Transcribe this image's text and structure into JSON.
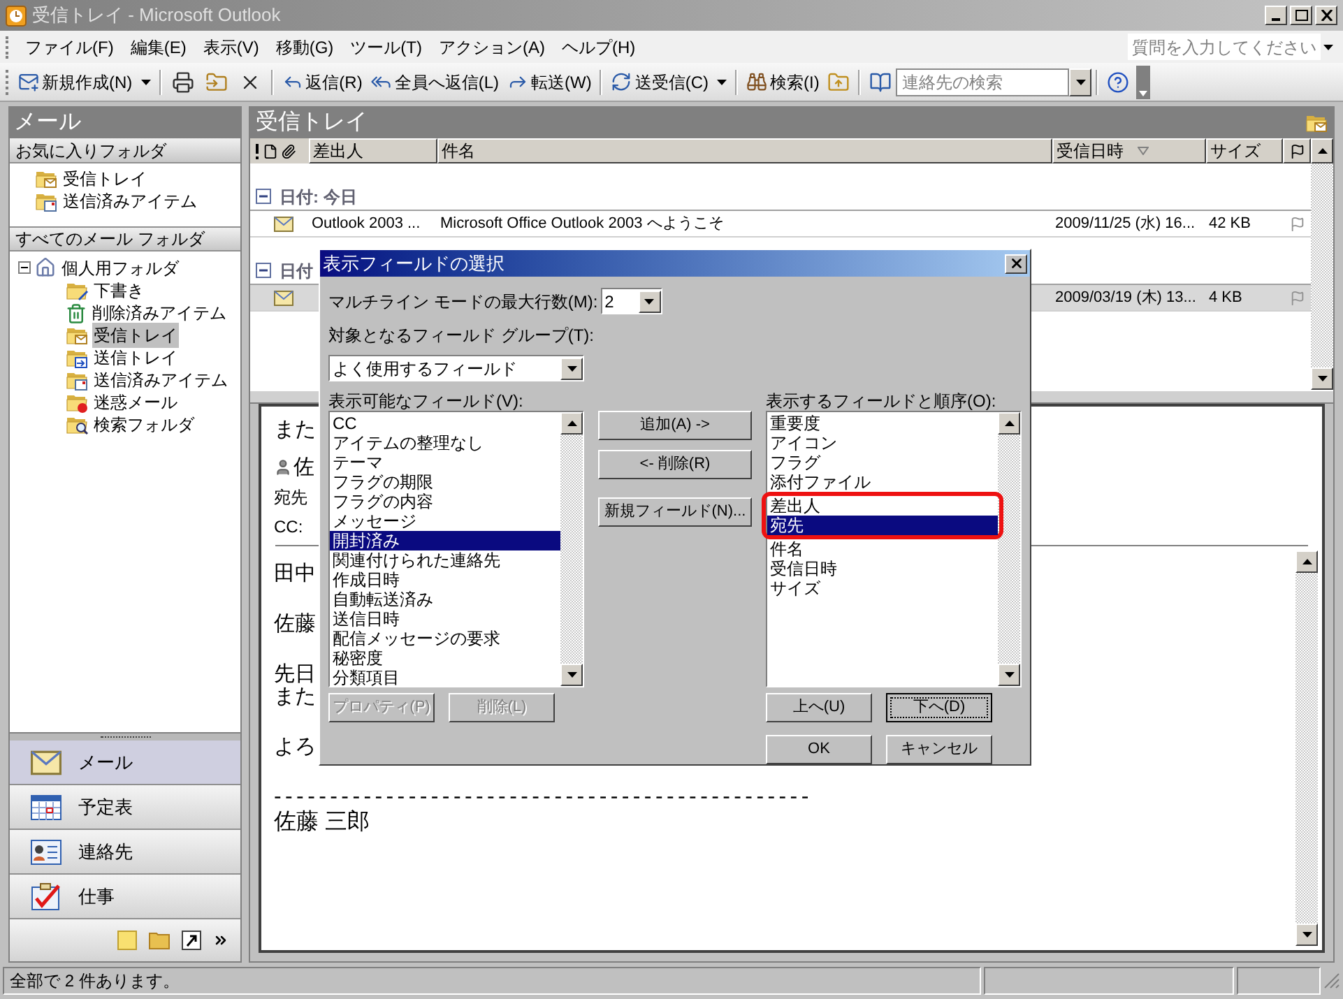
{
  "window": {
    "title": "受信トレイ - Microsoft Outlook"
  },
  "menu": [
    "ファイル(F)",
    "編集(E)",
    "表示(V)",
    "移動(G)",
    "ツール(T)",
    "アクション(A)",
    "ヘルプ(H)"
  ],
  "help_search": {
    "placeholder": "質問を入力してください"
  },
  "toolbar": {
    "new": "新規作成(N)",
    "reply": "返信(R)",
    "reply_all": "全員へ返信(L)",
    "forward": "転送(W)",
    "send_receive": "送受信(C)",
    "find": "検索(I)",
    "contact_search": {
      "placeholder": "連絡先の検索"
    }
  },
  "nav": {
    "title": "メール",
    "favorites": {
      "heading": "お気に入りフォルダ",
      "items": [
        {
          "label": "受信トレイ"
        },
        {
          "label": "送信済みアイテム"
        }
      ]
    },
    "all_folders": {
      "heading": "すべてのメール フォルダ",
      "tree": [
        {
          "label": "個人用フォルダ",
          "expanded": true,
          "selected": false,
          "children": [
            {
              "label": "下書き",
              "selected": false
            },
            {
              "label": "削除済みアイテム",
              "selected": false
            },
            {
              "label": "受信トレイ",
              "selected": true
            },
            {
              "label": "送信トレイ",
              "selected": false
            },
            {
              "label": "送信済みアイテム",
              "selected": false
            },
            {
              "label": "迷惑メール",
              "selected": false
            },
            {
              "label": "検索フォルダ",
              "selected": false
            }
          ]
        }
      ]
    },
    "buttons": [
      {
        "label": "メール",
        "selected": true
      },
      {
        "label": "予定表",
        "selected": false
      },
      {
        "label": "連絡先",
        "selected": false
      },
      {
        "label": "仕事",
        "selected": false
      }
    ]
  },
  "inbox": {
    "title": "受信トレイ",
    "columns": [
      {
        "label": "差出人",
        "sorted": false
      },
      {
        "label": "件名",
        "sorted": false
      },
      {
        "label": "受信日時",
        "sorted": true
      },
      {
        "label": "サイズ",
        "sorted": false
      }
    ],
    "groups": [
      {
        "label": "日付: 今日",
        "expanded": true,
        "rows": [
          {
            "from": "Outlook 2003 ...",
            "subject": "Microsoft Office Outlook 2003 へようこそ",
            "received": "2009/11/25 (水) 16...",
            "size": "42 KB",
            "selected": false
          }
        ]
      },
      {
        "label": "日付",
        "expanded": true,
        "rows": [
          {
            "received": "2009/03/19 (木) 13...",
            "size": "4 KB",
            "selected": true
          }
        ]
      }
    ]
  },
  "reading_pane": {
    "subject": "また",
    "sender": "佐",
    "to_label": "宛先",
    "cc_label": "CC:",
    "paragraphs": [
      {
        "lines": [
          "田中"
        ]
      },
      {
        "lines": [
          "佐藤"
        ]
      },
      {
        "lines": [
          "先日",
          "また"
        ]
      },
      {
        "lines": [
          "よろ"
        ]
      }
    ],
    "signature": {
      "rule": "------------------------------------------------",
      "name": "佐藤 三郎"
    }
  },
  "dialog": {
    "title": "表示フィールドの選択",
    "max_lines_label": "マルチライン モードの最大行数(M):",
    "max_lines_value": "2",
    "group_label": "対象となるフィールド グループ(T):",
    "group_value": "よく使用するフィールド",
    "available_label": "表示可能なフィールド(V):",
    "available": [
      {
        "label": "CC",
        "selected": false
      },
      {
        "label": "アイテムの整理なし",
        "selected": false
      },
      {
        "label": "テーマ",
        "selected": false
      },
      {
        "label": "フラグの期限",
        "selected": false
      },
      {
        "label": "フラグの内容",
        "selected": false
      },
      {
        "label": "メッセージ",
        "selected": false
      },
      {
        "label": "開封済み",
        "selected": true
      },
      {
        "label": "関連付けられた連絡先",
        "selected": false
      },
      {
        "label": "作成日時",
        "selected": false
      },
      {
        "label": "自動転送済み",
        "selected": false
      },
      {
        "label": "送信日時",
        "selected": false
      },
      {
        "label": "配信メッセージの要求",
        "selected": false
      },
      {
        "label": "秘密度",
        "selected": false
      },
      {
        "label": "分類項目",
        "selected": false
      }
    ],
    "move_buttons": [
      "追加(A) ->",
      "<- 削除(R)",
      "新規フィールド(N)..."
    ],
    "shown_label": "表示するフィールドと順序(O):",
    "shown": [
      {
        "label": "重要度",
        "selected": false,
        "highlighted": false
      },
      {
        "label": "アイコン",
        "selected": false,
        "highlighted": false
      },
      {
        "label": "フラグ",
        "selected": false,
        "highlighted": false
      },
      {
        "label": "添付ファイル",
        "selected": false,
        "highlighted": false
      },
      {
        "label": "差出人",
        "selected": false,
        "highlighted": true
      },
      {
        "label": "宛先",
        "selected": true,
        "highlighted": true
      },
      {
        "label": "件名",
        "selected": false,
        "highlighted": false
      },
      {
        "label": "受信日時",
        "selected": false,
        "highlighted": false
      },
      {
        "label": "サイズ",
        "selected": false,
        "highlighted": false
      }
    ],
    "field_buttons": [
      {
        "label": "プロパティ(P)",
        "disabled": true
      },
      {
        "label": "削除(L)",
        "disabled": true
      }
    ],
    "order_buttons": [
      {
        "label": "上へ(U)",
        "focused": false
      },
      {
        "label": "下へ(D)",
        "focused": true
      }
    ],
    "ok": "OK",
    "cancel": "キャンセル"
  },
  "status_bar": "全部で 2 件あります。"
}
